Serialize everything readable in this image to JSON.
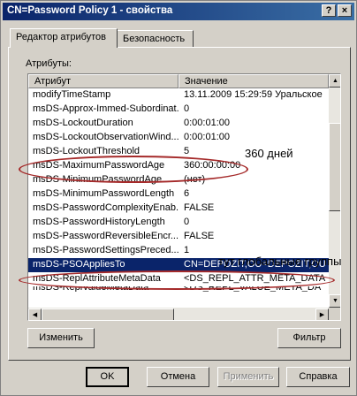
{
  "window": {
    "title": "CN=Password Policy 1 - свойства",
    "help_button": "?",
    "close_button": "×"
  },
  "tabs": [
    {
      "label": "Редактор атрибутов",
      "active": true
    },
    {
      "label": "Безопасность",
      "active": false
    }
  ],
  "attributes_label": "Атрибуты:",
  "columns": {
    "attribute": "Атрибут",
    "value": "Значение"
  },
  "rows": [
    {
      "attribute": "modifyTimeStamp",
      "value": "13.11.2009 15:29:59 Уральское"
    },
    {
      "attribute": "msDS-Approx-Immed-Subordinat...",
      "value": "0"
    },
    {
      "attribute": "msDS-LockoutDuration",
      "value": "0:00:01:00"
    },
    {
      "attribute": "msDS-LockoutObservationWind...",
      "value": "0:00:01:00"
    },
    {
      "attribute": "msDS-LockoutThreshold",
      "value": "5"
    },
    {
      "attribute": "msDS-MaximumPasswordAge",
      "value": "360:00:00:00"
    },
    {
      "attribute": "msDS-MinimumPasswordAge",
      "value": "(нет)"
    },
    {
      "attribute": "msDS-MinimumPasswordLength",
      "value": "6"
    },
    {
      "attribute": "msDS-PasswordComplexityEnab...",
      "value": "FALSE"
    },
    {
      "attribute": "msDS-PasswordHistoryLength",
      "value": "0"
    },
    {
      "attribute": "msDS-PasswordReversibleEncr...",
      "value": "FALSE"
    },
    {
      "attribute": "msDS-PasswordSettingsPreced...",
      "value": "1"
    },
    {
      "attribute": "msDS-PSOAppliesTo",
      "value": "CN=DEPOZIT,OU=DEPOZIT,OU",
      "selected": true
    },
    {
      "attribute": "msDS-ReplAttributeMetaData",
      "value": "<DS_REPL_ATTR_META_DATA"
    },
    {
      "attribute": "msDS-ReplValueMetaData",
      "value": "<DS_REPL_VALUE_META_DA"
    }
  ],
  "annotations": {
    "max_age_note": "360 дней",
    "applies_to_note": "тут глобальные группы"
  },
  "buttons": {
    "change": "Изменить",
    "filter": "Фильтр",
    "ok": "OK",
    "cancel": "Отмена",
    "apply": "Применить",
    "help": "Справка"
  },
  "colors": {
    "titlebar_start": "#0a246a",
    "titlebar_end": "#3a6ea5",
    "selection": "#0a246a",
    "annotation_ellipse": "#a52a2a",
    "face": "#d4d0c8"
  },
  "scroll": {
    "vertical_position": 0.3,
    "horizontal_position": 0.0
  }
}
